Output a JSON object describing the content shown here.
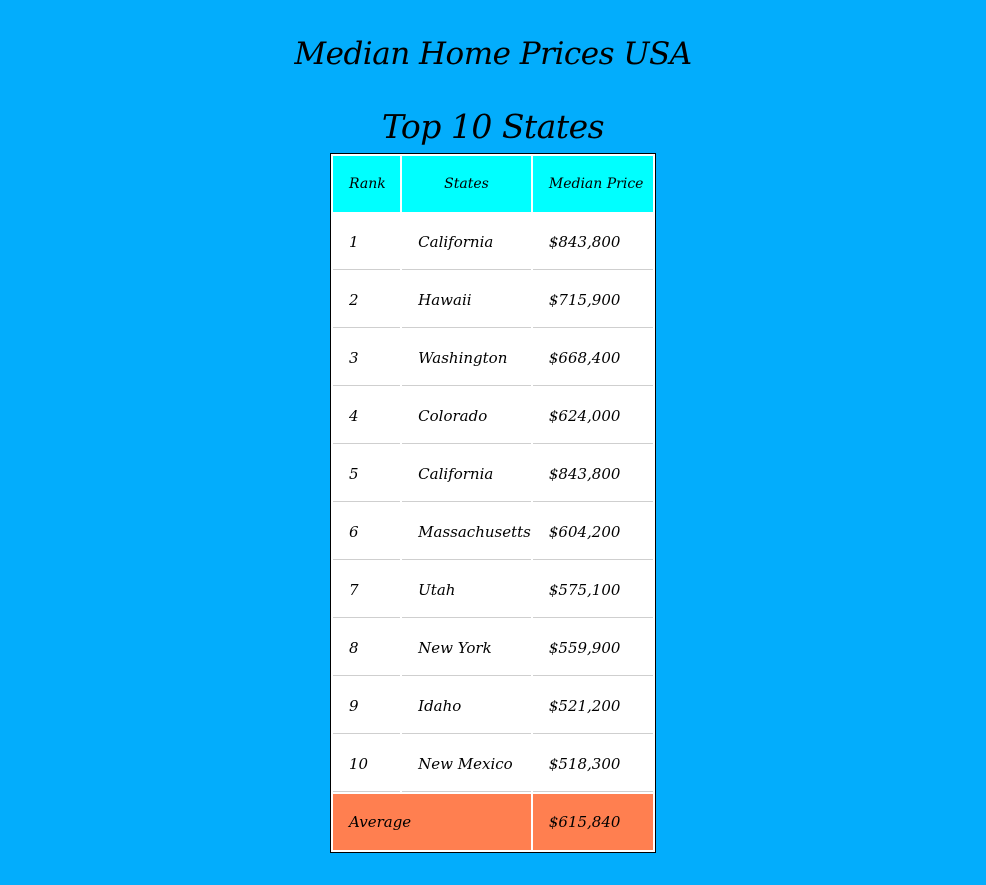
{
  "page": {
    "title": "Median Home Prices USA",
    "subtitle": "Top 10 States"
  },
  "table": {
    "headers": [
      "Rank",
      "States",
      "Median Price"
    ],
    "rows": [
      {
        "rank": "1",
        "state": "California",
        "price": "$843,800"
      },
      {
        "rank": "2",
        "state": "Hawaii",
        "price": "$715,900"
      },
      {
        "rank": "3",
        "state": "Washington",
        "price": "$668,400"
      },
      {
        "rank": "4",
        "state": "Colorado",
        "price": "$624,000"
      },
      {
        "rank": "5",
        "state": "California",
        "price": "$843,800"
      },
      {
        "rank": "6",
        "state": "Massachusetts",
        "price": "$604,200"
      },
      {
        "rank": "7",
        "state": "Utah",
        "price": "$575,100"
      },
      {
        "rank": "8",
        "state": "New York",
        "price": "$559,900"
      },
      {
        "rank": "9",
        "state": "Idaho",
        "price": "$521,200"
      },
      {
        "rank": "10",
        "state": "New Mexico",
        "price": "$518,300"
      }
    ],
    "footer": {
      "label": "Average",
      "value": "$615,840"
    }
  },
  "colors": {
    "page_background": "#03adfc",
    "header_background": "#00ffff",
    "footer_background": "#ff7f50",
    "body_background": "#ffffff"
  }
}
